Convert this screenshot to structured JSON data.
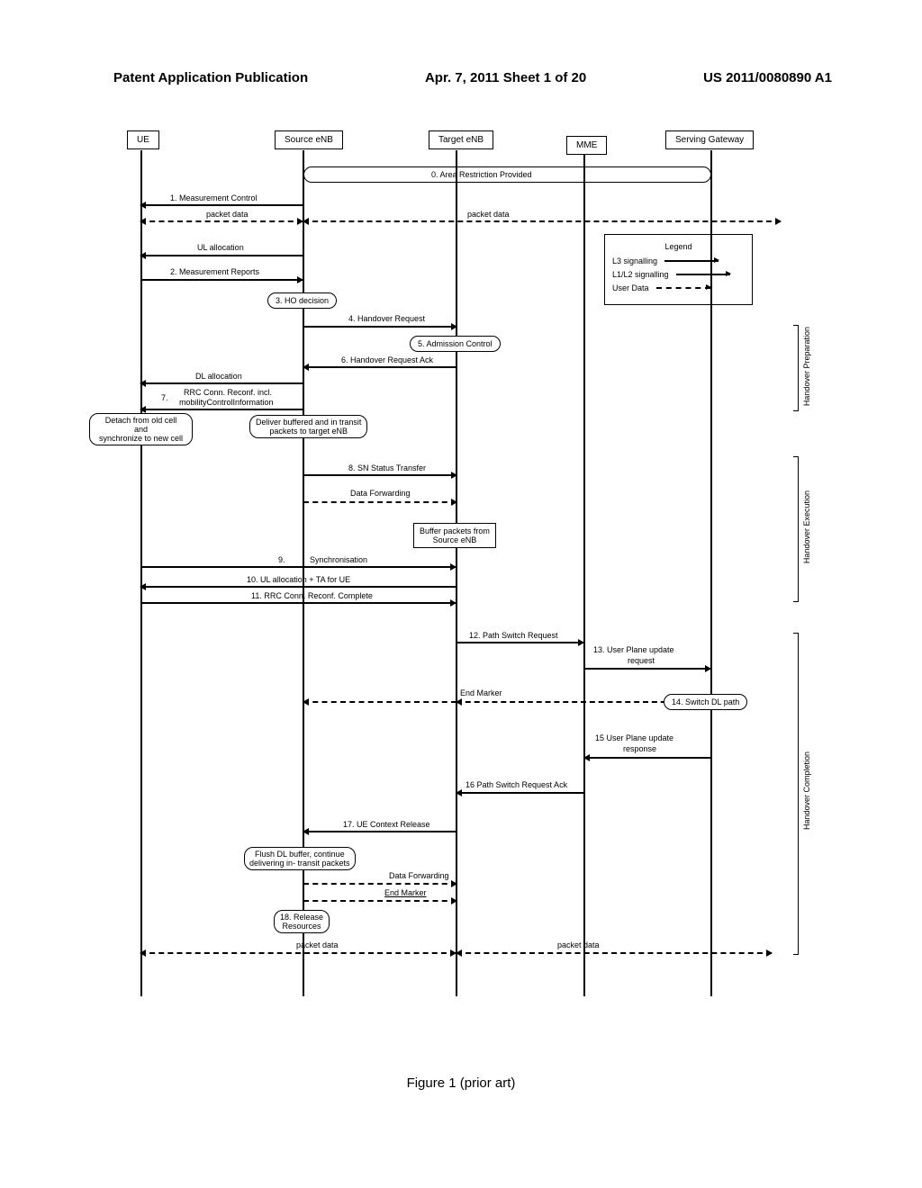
{
  "header": {
    "left": "Patent Application Publication",
    "center": "Apr. 7, 2011  Sheet 1 of 20",
    "right": "US 2011/0080890 A1"
  },
  "lifelines": {
    "ue": "UE",
    "source_enb": "Source eNB",
    "target_enb": "Target eNB",
    "mme": "MME",
    "gateway": "Serving   Gateway"
  },
  "messages": {
    "m0": "0.  Area Restriction Provided",
    "m1": "1.   Measurement Control",
    "packet_data": "packet data",
    "ul_alloc": "UL allocation",
    "m2": "2.     Measurement Reports",
    "m3": "3.  HO decision",
    "m4": "4.     Handover Request",
    "m5": "5.  Admission Control",
    "m6": "6.  Handover Request Ack",
    "dl_alloc": "DL  allocation",
    "m7a": "RRC Conn. Reconf. incl.",
    "m7b": "mobilityControlInformation",
    "m7_num": "7.",
    "detach1": "Detach from old cell",
    "detach2": "and",
    "detach3": "synchronize to new cell",
    "deliver1": "Deliver buffered and in transit",
    "deliver2": "packets to target eNB",
    "m8": "8.     SN Status Transfer",
    "data_fwd": "Data Forwarding",
    "buffer1": "Buffer packets from",
    "buffer2": "Source eNB",
    "m9": "Synchronisation",
    "m9_num": "9.",
    "m10": "10.     UL allocation    +  TA for UE",
    "m11": "11.      RRC Conn. Reconf. Complete",
    "m12": "12. Path Switch Request",
    "m13a": "13.  User Plane update",
    "m13b": "request",
    "end_marker": "End Marker",
    "m14": "14.    Switch DL path",
    "m15a": "15 User Plane update",
    "m15b": "response",
    "m16": "16 Path Switch Request Ack",
    "m17": "17.  UE Context Release",
    "flush1": "Flush DL buffer,",
    "flush2": "continue",
    "flush3": "delivering in- transit packets",
    "m18a": "18. Release",
    "m18b": "Resources"
  },
  "legend": {
    "title": "Legend",
    "l3": "L3  signalling",
    "l12": "L1/L2   signalling",
    "user": "User Data"
  },
  "side_labels": {
    "prep": "Handover Preparation",
    "exec": "Handover Execution",
    "comp": "Handover Completion"
  },
  "caption": "Figure 1 (prior art)"
}
